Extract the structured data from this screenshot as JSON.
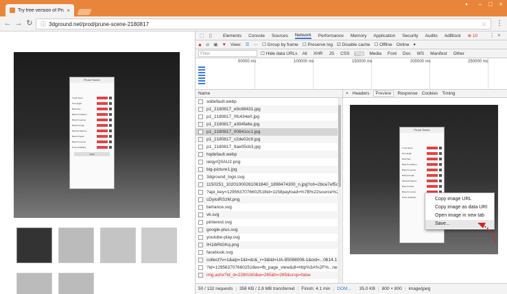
{
  "browser": {
    "tab_title": "Try free version of Prune",
    "url": "3dground.net/prod/prune-scene-2180817"
  },
  "devtools": {
    "tabs": [
      "Elements",
      "Console",
      "Sources",
      "Network",
      "Performance",
      "Memory",
      "Application",
      "Security",
      "Audits",
      "AdBlock"
    ],
    "active_tab": "Network",
    "error_count": "10",
    "toolbar": {
      "view_label": "View:",
      "group_by_frame": "Group by frame",
      "preserve_log": "Preserve log",
      "disable_cache": "Disable cache",
      "offline": "Offline",
      "online": "Online"
    },
    "filter": {
      "placeholder": "Filter",
      "hide_data_urls": "Hide data URLs",
      "types": [
        "All",
        "XHR",
        "JS",
        "CSS",
        "Img",
        "Media",
        "Font",
        "Doc",
        "WS",
        "Manifest",
        "Other"
      ],
      "active_type": "Img"
    },
    "overview": {
      "ticks": [
        "50000 ms",
        "100000 ms",
        "150000 ms",
        "200000 ms",
        "250000 ms"
      ]
    },
    "name_header": "Name",
    "requests": [
      "sddefault.webp",
      "p1_2180817_e9c88431.jpg",
      "p1_2180817_0fc434e0.jpg",
      "p1_2180817_a394fa6e.jpg",
      "p1_2180817_00841cc1.jpg",
      "p1_2180817_c2de02c9.jpg",
      "p1_2180817_9ae05cb3.jpg",
      "hqdefault.webp",
      "ieiqyrQ0AU2.png",
      "big-picture1.jpg",
      "3dground_logo.svg",
      "1150251_10201000261061840_1898474300_n.jpg?oh=2bce7ef5c6b",
      "?api_key=1295637076602518id=1158payload=%7B%22source%22",
      "cDyIoiRSzM.png",
      "behance.svg",
      "vk.svg",
      "pinterest.svg",
      "google-plus.svg",
      "youtube-play.svg",
      "IH1ibRtGKq.png",
      "facebook.svg",
      "collect?v=1&aip=1&t=dc&_r=3&tid=UA-85088006-1&cid=...0614.1",
      "?id=1295637076602518ev=fb_page_view&dl=http%3A%2F%...net",
      "img.ashx?id_d=2280160&w=265&h=265&crop=false"
    ],
    "selected_index": 4,
    "error_index": 23,
    "detail_tabs": [
      "Headers",
      "Preview",
      "Response",
      "Cookies",
      "Timing"
    ],
    "active_detail_tab": "Preview",
    "context_menu": [
      "Copy image URL",
      "Copy image as data URI",
      "Open image in new tab",
      "Save..."
    ],
    "context_menu_highlight": 3,
    "status": {
      "requests": "50 / 132 requests",
      "transferred": "358 KB / 2.8 MB transferred",
      "finish": "Finish: 4.1 min",
      "dom": "DOM...",
      "size": "35.0 KB",
      "dimensions": "800 × 800",
      "mime": "image/jpeg"
    }
  },
  "mini_ui": {
    "title": "Prune Scene",
    "rows": [
      "Trunk Sizes",
      "Set Height",
      "Branches",
      "Branch Collision",
      "Branch Leaves",
      "Branch Angle",
      "Minimal Stamps",
      "Branch Seed",
      "Branch Lenses",
      "Prune Enabled"
    ],
    "button": "Apply",
    "footer_items": [
      "Updates",
      "Tutorials",
      "About"
    ]
  }
}
